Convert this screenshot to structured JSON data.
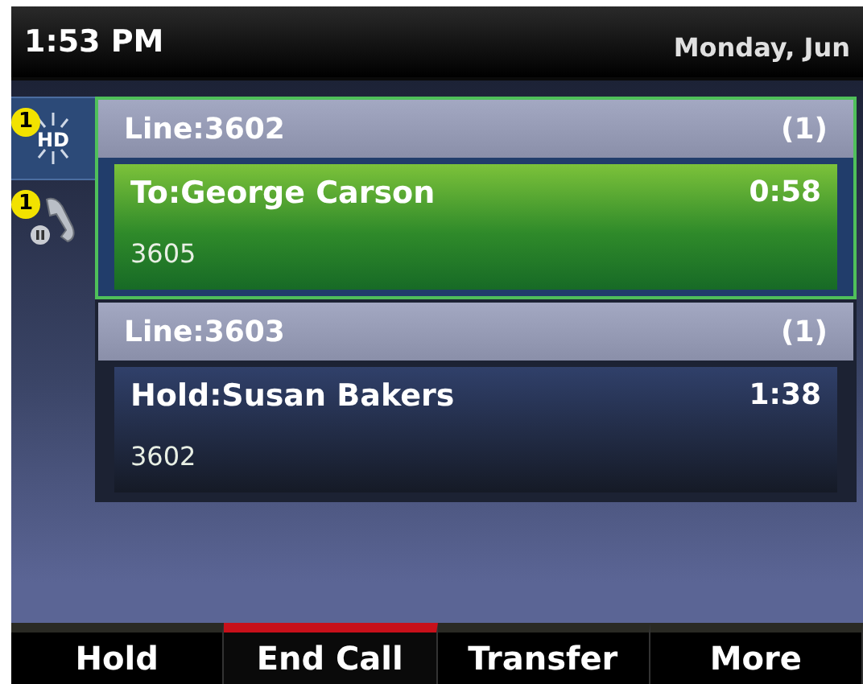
{
  "status_bar": {
    "time": "1:53 PM",
    "date": "Monday, Jun"
  },
  "line_keys": [
    {
      "kind": "hd",
      "icon_text": "HD",
      "badge": "1",
      "selected": true
    },
    {
      "kind": "hold",
      "badge": "1",
      "selected": false
    }
  ],
  "lines": [
    {
      "label": "Line:3602",
      "count": "(1)",
      "selected": true,
      "call": {
        "kind": "active",
        "name": "To:George Carson",
        "number": "3605",
        "duration": "0:58"
      }
    },
    {
      "label": "Line:3603",
      "count": "(1)",
      "selected": false,
      "call": {
        "kind": "held",
        "name": "Hold:Susan Bakers",
        "number": "3602",
        "duration": "1:38"
      }
    }
  ],
  "softkeys": [
    {
      "label": "Hold",
      "highlighted": false
    },
    {
      "label": "End Call",
      "highlighted": true
    },
    {
      "label": "Transfer",
      "highlighted": false
    },
    {
      "label": "More",
      "highlighted": false
    }
  ]
}
